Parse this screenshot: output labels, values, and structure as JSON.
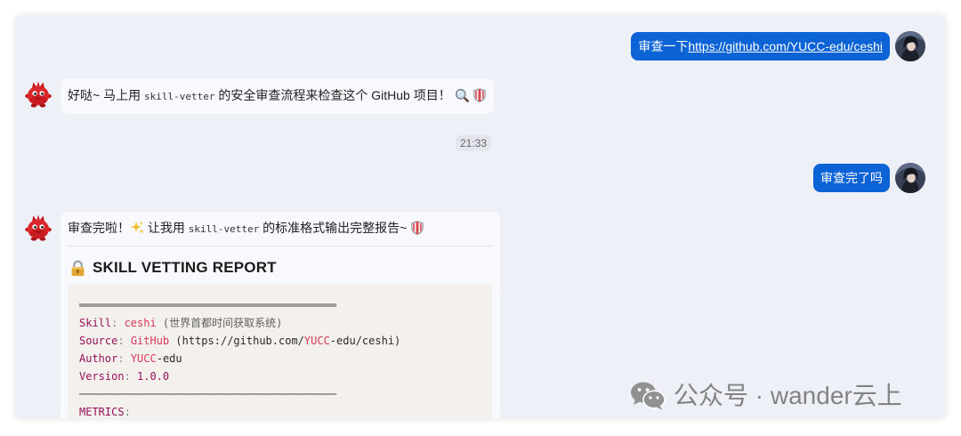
{
  "colors": {
    "page_bg": "#ffffff",
    "chat_bg": "#eef0f7",
    "user_bubble": "#0b63d6",
    "assistant_bubble": "#f8f9fd",
    "code_bg": "#f4f1ed"
  },
  "messages": [
    {
      "avatar": "user-avatar",
      "text": "审查一下",
      "link": "https://github.com/YUCC-edu/ceshi"
    },
    {
      "avatar": "red-mascot-avatar",
      "text_before": "好哒~ 马上用 ",
      "inline_code": "skill-vetter",
      "text_after": " 的安全审查流程来检查这个 GitHub 项目！",
      "trailing_icons": [
        "magnifying-glass-icon",
        "shield-icon"
      ]
    },
    {
      "avatar": "user-avatar",
      "text": "审查完了吗"
    },
    {
      "avatar": "red-mascot-avatar",
      "text_before": "审查完啦！",
      "middle_icon": "sparkles-icon",
      "text_middle": " 让我用 ",
      "inline_code": "skill-vetter",
      "text_after": " 的标准格式输出完整报告~ ",
      "trailing_icons": [
        "shield-icon"
      ],
      "report": {
        "heading_icon": "lock-icon",
        "heading": "SKILL VETTING REPORT",
        "code_lines": [
          [
            {
              "text": "════════════════════════════════════════",
              "color": "#4a4a4a"
            }
          ],
          [
            {
              "text": "Skill",
              "color": "#97105c"
            },
            {
              "text": ": ",
              "color": "#8a8a8a"
            },
            {
              "text": "ceshi",
              "color": "#d8365d"
            },
            {
              "text": " (世界首都时间获取系统)",
              "color": "#5e5e5e"
            }
          ],
          [
            {
              "text": "Source",
              "color": "#97105c"
            },
            {
              "text": ": ",
              "color": "#8a8a8a"
            },
            {
              "text": "GitHub",
              "color": "#d8365d"
            },
            {
              "text": " (https://github.com/",
              "color": "#2a2a2a"
            },
            {
              "text": "YUCC",
              "color": "#d8365d"
            },
            {
              "text": "-edu/ceshi)",
              "color": "#2a2a2a"
            }
          ],
          [
            {
              "text": "Author",
              "color": "#97105c"
            },
            {
              "text": ": ",
              "color": "#8a8a8a"
            },
            {
              "text": "YUCC",
              "color": "#d8365d"
            },
            {
              "text": "-edu",
              "color": "#2a2a2a"
            }
          ],
          [
            {
              "text": "Version",
              "color": "#97105c"
            },
            {
              "text": ": ",
              "color": "#8a8a8a"
            },
            {
              "text": "1.0.0",
              "color": "#97105c"
            }
          ],
          [
            {
              "text": "────────────────────────────────────────",
              "color": "#4a4a4a"
            }
          ],
          [
            {
              "text": "METRICS",
              "color": "#97105c"
            },
            {
              "text": ":",
              "color": "#8a8a8a"
            }
          ]
        ]
      }
    }
  ],
  "timestamp": "21:33",
  "watermark": {
    "icon": "wechat-icon",
    "text": "公众号 · wander云上"
  }
}
